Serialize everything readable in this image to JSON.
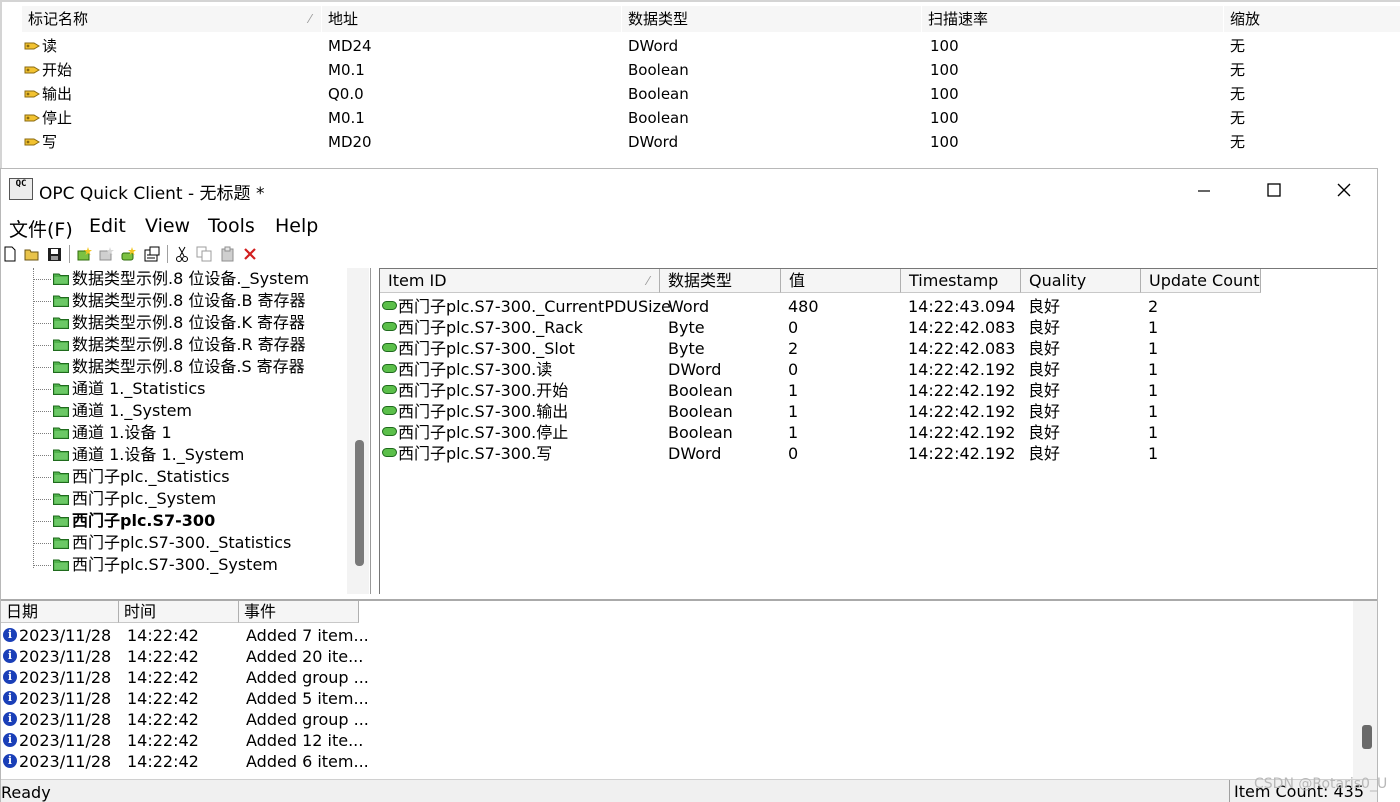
{
  "background_table": {
    "columns": [
      "标记名称",
      "地址",
      "数据类型",
      "扫描速率",
      "缩放"
    ],
    "rows": [
      [
        "读",
        "MD24",
        "DWord",
        "100",
        "无"
      ],
      [
        "开始",
        "M0.1",
        "Boolean",
        "100",
        "无"
      ],
      [
        "输出",
        "Q0.0",
        "Boolean",
        "100",
        "无"
      ],
      [
        "停止",
        "M0.1",
        "Boolean",
        "100",
        "无"
      ],
      [
        "写",
        "MD20",
        "DWord",
        "100",
        "无"
      ]
    ]
  },
  "window": {
    "title": "OPC Quick Client - 无标题 *",
    "app_icon_text": "QC",
    "minimize_icon": "minimize-icon",
    "maximize_icon": "maximize-icon",
    "close_icon": "close-icon"
  },
  "menu": [
    "文件(F)",
    "Edit",
    "View",
    "Tools",
    "Help"
  ],
  "toolbar": [
    "new-icon",
    "open-icon",
    "save-icon",
    "new-server-icon",
    "new-group-icon",
    "new-item-icon",
    "properties-icon",
    "cut-icon",
    "copy-icon",
    "paste-icon",
    "delete-icon"
  ],
  "tree": {
    "items": [
      {
        "label": "数据类型示例.8 位设备._System",
        "bold": false
      },
      {
        "label": "数据类型示例.8 位设备.B 寄存器",
        "bold": false
      },
      {
        "label": "数据类型示例.8 位设备.K 寄存器",
        "bold": false
      },
      {
        "label": "数据类型示例.8 位设备.R 寄存器",
        "bold": false
      },
      {
        "label": "数据类型示例.8 位设备.S 寄存器",
        "bold": false
      },
      {
        "label": "通道 1._Statistics",
        "bold": false
      },
      {
        "label": "通道 1._System",
        "bold": false
      },
      {
        "label": "通道 1.设备 1",
        "bold": false
      },
      {
        "label": "通道 1.设备 1._System",
        "bold": false
      },
      {
        "label": "西门子plc._Statistics",
        "bold": false
      },
      {
        "label": "西门子plc._System",
        "bold": false
      },
      {
        "label": "西门子plc.S7-300",
        "bold": true
      },
      {
        "label": "西门子plc.S7-300._Statistics",
        "bold": false
      },
      {
        "label": "西门子plc.S7-300._System",
        "bold": false
      }
    ]
  },
  "items_table": {
    "columns": [
      "Item ID",
      "数据类型",
      "值",
      "Timestamp",
      "Quality",
      "Update Count"
    ],
    "rows": [
      [
        "西门子plc.S7-300._CurrentPDUSize",
        "Word",
        "480",
        "14:22:43.094",
        "良好",
        "2"
      ],
      [
        "西门子plc.S7-300._Rack",
        "Byte",
        "0",
        "14:22:42.083",
        "良好",
        "1"
      ],
      [
        "西门子plc.S7-300._Slot",
        "Byte",
        "2",
        "14:22:42.083",
        "良好",
        "1"
      ],
      [
        "西门子plc.S7-300.读",
        "DWord",
        "0",
        "14:22:42.192",
        "良好",
        "1"
      ],
      [
        "西门子plc.S7-300.开始",
        "Boolean",
        "1",
        "14:22:42.192",
        "良好",
        "1"
      ],
      [
        "西门子plc.S7-300.输出",
        "Boolean",
        "1",
        "14:22:42.192",
        "良好",
        "1"
      ],
      [
        "西门子plc.S7-300.停止",
        "Boolean",
        "1",
        "14:22:42.192",
        "良好",
        "1"
      ],
      [
        "西门子plc.S7-300.写",
        "DWord",
        "0",
        "14:22:42.192",
        "良好",
        "1"
      ]
    ]
  },
  "event_log": {
    "columns": [
      "日期",
      "时间",
      "事件"
    ],
    "rows": [
      [
        "2023/11/28",
        "14:22:42",
        "Added 7 item..."
      ],
      [
        "2023/11/28",
        "14:22:42",
        "Added 20 ite..."
      ],
      [
        "2023/11/28",
        "14:22:42",
        "Added group ..."
      ],
      [
        "2023/11/28",
        "14:22:42",
        "Added 5 item..."
      ],
      [
        "2023/11/28",
        "14:22:42",
        "Added group ..."
      ],
      [
        "2023/11/28",
        "14:22:42",
        "Added 12 ite..."
      ],
      [
        "2023/11/28",
        "14:22:42",
        "Added 6 item..."
      ]
    ]
  },
  "status": {
    "text": "Ready",
    "item_count": "Item Count: 435"
  },
  "watermark": "CSDN @Rotaris0_U"
}
